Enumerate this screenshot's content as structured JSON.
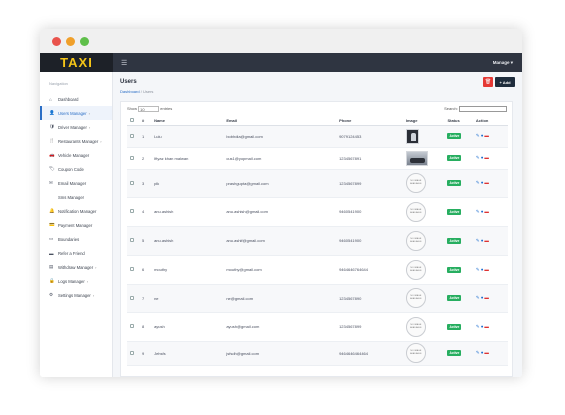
{
  "window": {
    "dots": [
      "#e9534c",
      "#f0a02b",
      "#5fbf4a"
    ]
  },
  "brand": "TAXI",
  "topbar": {
    "manage_label": "Manage ▾",
    "menu_icon": "hamburger-icon"
  },
  "sidebar": {
    "title": "Navigation",
    "items": [
      {
        "label": "Dashboard",
        "icon": "home-icon",
        "chevron": ""
      },
      {
        "label": "Users Manager",
        "icon": "user-icon",
        "chevron": "›"
      },
      {
        "label": "Driver Manager",
        "icon": "driver-icon",
        "chevron": "›"
      },
      {
        "label": "Restaurants Manager",
        "icon": "restaurant-icon",
        "chevron": "›"
      },
      {
        "label": "Vehicle Manager",
        "icon": "car-icon",
        "chevron": ""
      },
      {
        "label": "Coupon Code",
        "icon": "tag-icon",
        "chevron": ""
      },
      {
        "label": "Email Manager",
        "icon": "mail-icon",
        "chevron": ""
      },
      {
        "label": "Sms Manager",
        "icon": "sms-icon",
        "chevron": ""
      },
      {
        "label": "Notification Manager",
        "icon": "bell-icon",
        "chevron": ""
      },
      {
        "label": "Payment Manager",
        "icon": "payment-icon",
        "chevron": ""
      },
      {
        "label": "Boundaries",
        "icon": "map-icon",
        "chevron": ""
      },
      {
        "label": "Refer a Friend",
        "icon": "share-icon",
        "chevron": ""
      },
      {
        "label": "Withdraw Manager",
        "icon": "wallet-icon",
        "chevron": "›"
      },
      {
        "label": "Logs Manager",
        "icon": "log-icon",
        "chevron": "›"
      },
      {
        "label": "Settings Manager",
        "icon": "gear-icon",
        "chevron": "›"
      }
    ]
  },
  "page": {
    "title": "Users",
    "breadcrumb_link": "Dashboard",
    "breadcrumb_sep": "/",
    "breadcrumb_current": "Users",
    "delete_icon": "🗑",
    "add_label": "+ Add"
  },
  "table_tools": {
    "show_label": "Show",
    "page_size": "10",
    "entries_label": "entries",
    "search_label": "Search:"
  },
  "table": {
    "columns": [
      "",
      "#",
      "Name",
      "Email",
      "Phone",
      "Image",
      "Status",
      "Action"
    ],
    "rows": [
      {
        "num": "1",
        "name": "Lulu",
        "email": "bobhdia@gmail.com",
        "phone": "9079124453",
        "image": "photo",
        "status": "Active"
      },
      {
        "num": "2",
        "name": "Iftyaz khan malwan",
        "email": "cus1@yopmail.com",
        "phone": "1234567891",
        "image": "car",
        "status": "Active"
      },
      {
        "num": "3",
        "name": "plk",
        "email": "prashgupta@gmail.com",
        "phone": "1234567899",
        "image": "none",
        "status": "Active"
      },
      {
        "num": "4",
        "name": "anu.ashish",
        "email": "anu.ashish@gmail.com",
        "phone": "9460541900",
        "image": "none",
        "status": "Active"
      },
      {
        "num": "5",
        "name": "anu.ashish",
        "email": "anu.ashif@gmail.com",
        "phone": "9460541900",
        "image": "none",
        "status": "Active"
      },
      {
        "num": "6",
        "name": "mouthy",
        "email": "mouthy@gmail.com",
        "phone": "9464646764644",
        "image": "none",
        "status": "Active"
      },
      {
        "num": "7",
        "name": "ne",
        "email": "ne@gmail.com",
        "phone": "1234567890",
        "image": "none",
        "status": "Active"
      },
      {
        "num": "8",
        "name": "ayush",
        "email": "ayush@gmail.com",
        "phone": "1234567899",
        "image": "none",
        "status": "Active"
      },
      {
        "num": "9",
        "name": "Jehsfs",
        "email": "jsfsdh@gmail.com",
        "phone": "9464646464464",
        "image": "none",
        "status": "Active"
      }
    ],
    "no_image_text": "NO IMAGE AVAILABLE"
  },
  "colors": {
    "brand_yellow": "#f5c518",
    "topbar": "#2f3541",
    "active_green": "#27ae60",
    "delete_red": "#e53935"
  }
}
